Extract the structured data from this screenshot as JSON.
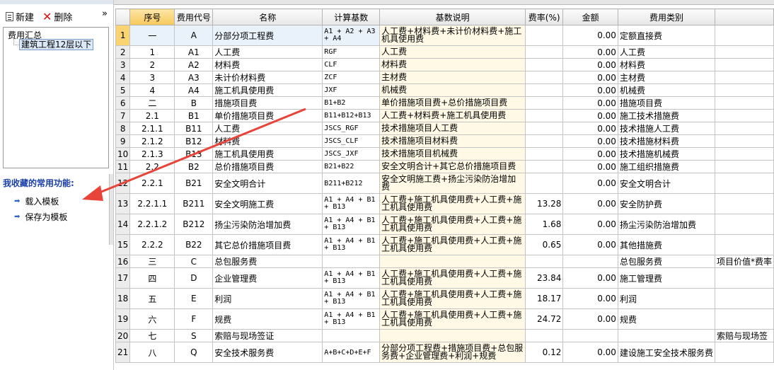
{
  "left": {
    "toolbar": {
      "new_label": "新建",
      "delete_label": "删除",
      "collapse": "»"
    },
    "tree": {
      "root": "费用汇总",
      "child": "建筑工程12层以下"
    },
    "favorites": {
      "title": "我收藏的常用功能:",
      "items": [
        "载入模板",
        "保存为模板"
      ]
    }
  },
  "grid": {
    "columns": [
      "",
      "序号",
      "费用代号",
      "名称",
      "计算基数",
      "基数说明",
      "费率(%)",
      "金额",
      "费用类别",
      ""
    ],
    "rows": [
      {
        "rn": "1",
        "seq": "一",
        "code": "A",
        "name": "分部分项工程费",
        "base": "A1 + A2 + A3 + A4",
        "desc": "人工费+材料费+未计价材料费+施工机具使用费",
        "rate": "",
        "amount": "0.00",
        "cat": "定额直接费",
        "note": ""
      },
      {
        "rn": "2",
        "seq": "1",
        "code": "A1",
        "name": "人工费",
        "base": "RGF",
        "desc": "人工费",
        "rate": "",
        "amount": "0.00",
        "cat": "人工费",
        "note": ""
      },
      {
        "rn": "3",
        "seq": "2",
        "code": "A2",
        "name": "材料费",
        "base": "CLF",
        "desc": "材料费",
        "rate": "",
        "amount": "0.00",
        "cat": "材料费",
        "note": ""
      },
      {
        "rn": "4",
        "seq": "3",
        "code": "A3",
        "name": "未计价材料费",
        "base": "ZCF",
        "desc": "主材费",
        "rate": "",
        "amount": "0.00",
        "cat": "主材费",
        "note": ""
      },
      {
        "rn": "5",
        "seq": "4",
        "code": "A4",
        "name": "施工机具使用费",
        "base": "JXF",
        "desc": "机械费",
        "rate": "",
        "amount": "0.00",
        "cat": "机械费",
        "note": ""
      },
      {
        "rn": "6",
        "seq": "二",
        "code": "B",
        "name": "措施项目费",
        "base": "B1+B2",
        "desc": "单价措施项目费+总价措施项目费",
        "rate": "",
        "amount": "0.00",
        "cat": "措施项目费",
        "note": ""
      },
      {
        "rn": "7",
        "seq": "2.1",
        "code": "B1",
        "name": "单价措施项目费",
        "base": "B11+B12+B13",
        "desc": "人工费+材料费+施工机具使用费",
        "rate": "",
        "amount": "0.00",
        "cat": "施工技术措施费",
        "note": ""
      },
      {
        "rn": "8",
        "seq": "2.1.1",
        "code": "B11",
        "name": "人工费",
        "base": "JSCS_RGF",
        "desc": "技术措施项目人工费",
        "rate": "",
        "amount": "0.00",
        "cat": "技术措施人工费",
        "note": ""
      },
      {
        "rn": "9",
        "seq": "2.1.2",
        "code": "B12",
        "name": "材料费",
        "base": "JSCS_CLF",
        "desc": "技术措施项目材料费",
        "rate": "",
        "amount": "0.00",
        "cat": "技术措施材料费",
        "note": ""
      },
      {
        "rn": "10",
        "seq": "2.1.3",
        "code": "B13",
        "name": "施工机具使用费",
        "base": "JSCS_JXF",
        "desc": "技术措施项目机械费",
        "rate": "",
        "amount": "0.00",
        "cat": "技术措施机械费",
        "note": ""
      },
      {
        "rn": "11",
        "seq": "2.2",
        "code": "B2",
        "name": "总价措施项目费",
        "base": "B21+B22",
        "desc": "安全文明合计+其它总价措施项目费",
        "rate": "",
        "amount": "0.00",
        "cat": "施工组织措施费",
        "note": ""
      },
      {
        "rn": "12",
        "seq": "2.2.1",
        "code": "B21",
        "name": "安全文明合计",
        "base": "B211+B212",
        "desc": "安全文明施工费+扬尘污染防治增加费",
        "rate": "",
        "amount": "0.00",
        "cat": "安全文明合计",
        "note": ""
      },
      {
        "rn": "13",
        "seq": "2.2.1.1",
        "code": "B211",
        "name": "安全文明施工费",
        "base": "A1 + A4 + B1 + B13",
        "desc": "人工费+施工机具使用费+人工费+施工机具使用费",
        "rate": "13.28",
        "amount": "0.00",
        "cat": "安全防护费",
        "note": ""
      },
      {
        "rn": "14",
        "seq": "2.2.1.2",
        "code": "B212",
        "name": "扬尘污染防治增加费",
        "base": "A1 + A4 + B1 + B13",
        "desc": "人工费+施工机具使用费+人工费+施工机具使用费",
        "rate": "1.68",
        "amount": "0.00",
        "cat": "扬尘污染防治增加费",
        "note": ""
      },
      {
        "rn": "15",
        "seq": "2.2.2",
        "code": "B22",
        "name": "其它总价措施项目费",
        "base": "A1 + A4 + B1 + B13",
        "desc": "人工费+施工机具使用费+人工费+施工机具使用费",
        "rate": "0.65",
        "amount": "0.00",
        "cat": "其他措施费",
        "note": ""
      },
      {
        "rn": "16",
        "seq": "三",
        "code": "C",
        "name": "总包服务费",
        "base": "",
        "desc": "",
        "rate": "",
        "amount": "",
        "cat": "总包服务费",
        "note": "项目价值*费率"
      },
      {
        "rn": "17",
        "seq": "四",
        "code": "D",
        "name": "企业管理费",
        "base": "A1 + A4 + B1 + B13",
        "desc": "人工费+施工机具使用费+人工费+施工机具使用费",
        "rate": "23.84",
        "amount": "0.00",
        "cat": "施工管理费",
        "note": ""
      },
      {
        "rn": "18",
        "seq": "五",
        "code": "E",
        "name": "利润",
        "base": "A1 + A4 + B1 + B13",
        "desc": "人工费+施工机具使用费+人工费+施工机具使用费",
        "rate": "18.17",
        "amount": "0.00",
        "cat": "利润",
        "note": ""
      },
      {
        "rn": "19",
        "seq": "六",
        "code": "F",
        "name": "规费",
        "base": "A1 + A4 + B1 + B13",
        "desc": "人工费+施工机具使用费+人工费+施工机具使用费",
        "rate": "24.72",
        "amount": "0.00",
        "cat": "规费",
        "note": ""
      },
      {
        "rn": "20",
        "seq": "七",
        "code": "S",
        "name": "索赔与现场签证",
        "base": "",
        "desc": "",
        "rate": "",
        "amount": "",
        "cat": "",
        "note": "索赔与现场签"
      },
      {
        "rn": "21",
        "seq": "八",
        "code": "Q",
        "name": "安全技术服务费",
        "base": "A+B+C+D+E+F",
        "desc": "分部分项工程费+措施项目费+总包服务费+企业管理费+利润+规费",
        "rate": "0.12",
        "amount": "0.00",
        "cat": "建设施工安全技术服务费",
        "note": ""
      }
    ]
  },
  "icons": {
    "new": "new-document-icon",
    "delete": "delete-x-icon",
    "bullet": "arrow-bullet-icon",
    "annotation": "red-arrow-annotation"
  },
  "colors": {
    "accent": "#1a3ea8",
    "selected_row": "#f9d471",
    "annotation": "#e8443a"
  }
}
